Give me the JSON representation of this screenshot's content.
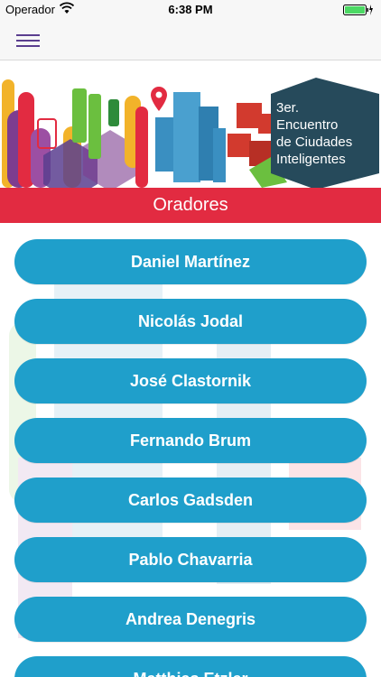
{
  "status": {
    "carrier": "Operador",
    "time": "6:38 PM"
  },
  "nav": {
    "menu_icon": "hamburger-icon"
  },
  "banner": {
    "title_lines": [
      "3er.",
      "Encuentro",
      "de Ciudades",
      "Inteligentes"
    ]
  },
  "section": {
    "title": "Oradores"
  },
  "speakers": [
    "Daniel Martínez",
    "Nicolás Jodal",
    "José Clastornik",
    "Fernando Brum",
    "Carlos Gadsden",
    "Pablo Chavarria",
    "Andrea Denegris",
    "Matthias Etzler"
  ],
  "colors": {
    "accent_red": "#e22b41",
    "button_blue": "#1f9fcb",
    "banner_navy": "#264a5b",
    "menu_purple": "#5a3e8f"
  }
}
